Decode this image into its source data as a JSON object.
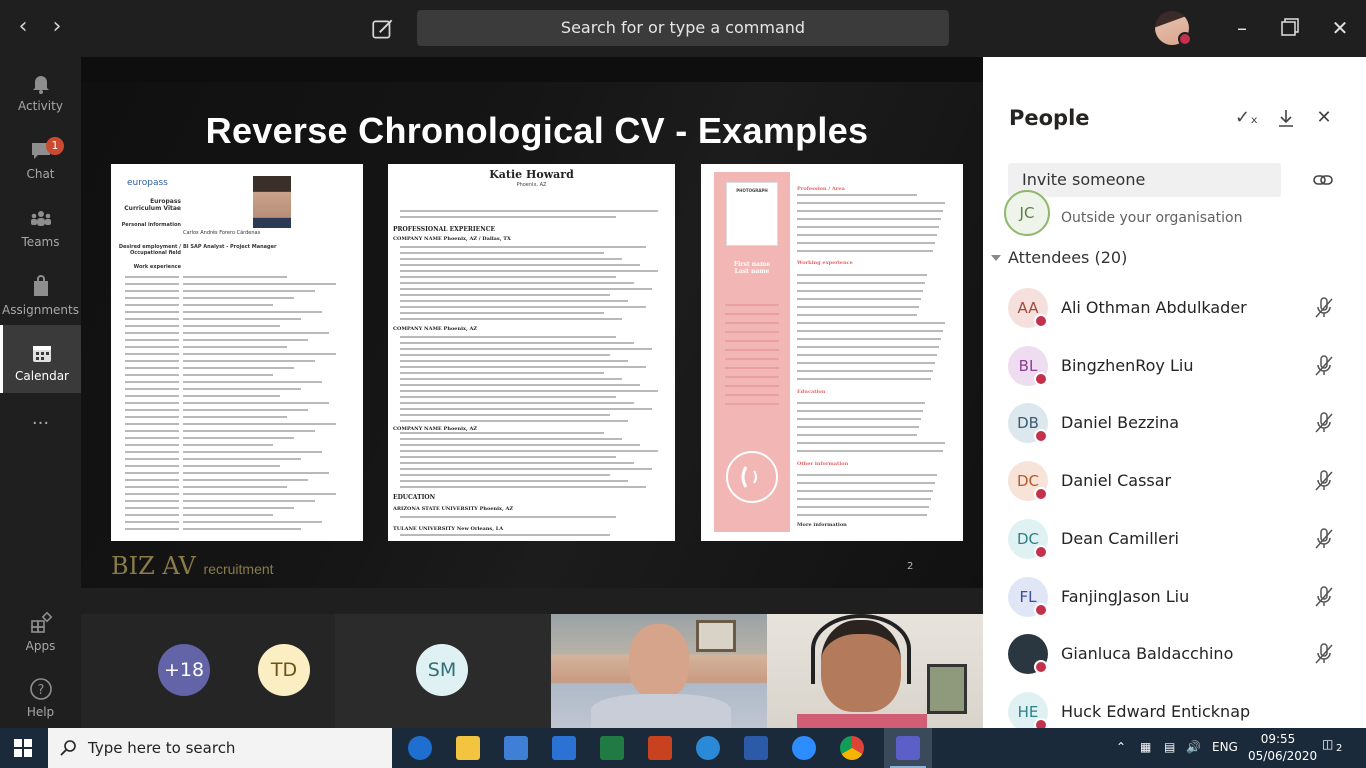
{
  "titlebar": {
    "search_placeholder": "Search for or type a command"
  },
  "rail": {
    "items": [
      {
        "label": "Activity"
      },
      {
        "label": "Chat",
        "badge": "1"
      },
      {
        "label": "Teams"
      },
      {
        "label": "Assignments"
      },
      {
        "label": "Calendar"
      },
      {
        "label": "Apps"
      },
      {
        "label": "Help"
      }
    ]
  },
  "slide": {
    "title": "Reverse Chronological CV - Examples",
    "logo": "BIZ AV",
    "logo_sub": "recruitment",
    "page_number": "2",
    "cv1": {
      "brand": "europass",
      "title_line1": "Europass",
      "title_line2": "Curriculum Vitae",
      "section": "Personal information",
      "name": "Carlos Andrés Forero Cárdenas",
      "position_label": "Desired employment / Occupational field",
      "position": "BI SAP Analyst - Project Manager",
      "work": "Work experience"
    },
    "cv2": {
      "name": "Katie Howard",
      "location": "Phoenix, AZ",
      "section1": "PROFESSIONAL EXPERIENCE",
      "company1": "COMPANY NAME  Phoenix, AZ / Dallas, TX",
      "company2": "COMPANY NAME  Phoenix, AZ",
      "company3": "COMPANY NAME  Phoenix, AZ",
      "section2": "EDUCATION",
      "school1": "ARIZONA STATE UNIVERSITY  Phoenix, AZ",
      "school2": "TULANE UNIVERSITY  New Orleans, LA"
    },
    "cv3": {
      "photo": "PHOTOGRAPH",
      "name_line1": "First name",
      "name_line2": "Last name",
      "profession": "Profession / Area",
      "working": "Working experience",
      "education": "Education",
      "other": "Other information",
      "more": "More information"
    }
  },
  "call": {
    "overflow": "+18",
    "tiles": [
      {
        "initials": "TD"
      },
      {
        "initials": "SM"
      }
    ]
  },
  "panel": {
    "title": "People",
    "invite_placeholder": "Invite someone",
    "outside_initials": "JC",
    "outside_label": "Outside your organisation",
    "attendees_label": "Attendees (20)",
    "people": [
      {
        "initials": "AA",
        "name": "Ali Othman Abdulkader",
        "color": "#f6e0dd",
        "text": "#a14a3c"
      },
      {
        "initials": "BL",
        "name": "BingzhenRoy Liu",
        "color": "#eedcf0",
        "text": "#8a3f93"
      },
      {
        "initials": "DB",
        "name": "Daniel Bezzina",
        "color": "#dde7ee",
        "text": "#3c5b72"
      },
      {
        "initials": "DC",
        "name": "Daniel Cassar",
        "color": "#f8e3d8",
        "text": "#b35a2b"
      },
      {
        "initials": "DC",
        "name": "Dean Camilleri",
        "color": "#dff1f2",
        "text": "#2f7f86"
      },
      {
        "initials": "FL",
        "name": "FanjingJason Liu",
        "color": "#e0e6f6",
        "text": "#3b4f96"
      },
      {
        "initials": "",
        "name": "Gianluca Baldacchino",
        "color": "#2a3640",
        "text": "#ffffff"
      },
      {
        "initials": "HE",
        "name": "Huck Edward Enticknap",
        "color": "#dff1f2",
        "text": "#2f7f86"
      }
    ]
  },
  "taskbar": {
    "search_placeholder": "Type here to search",
    "language": "ENG",
    "time": "09:55",
    "date": "05/06/2020",
    "notifications": "2"
  },
  "colors": {
    "accent_red": "#c4314b",
    "rail_bg": "#1f1f1f",
    "panel_bg": "#ffffff"
  }
}
